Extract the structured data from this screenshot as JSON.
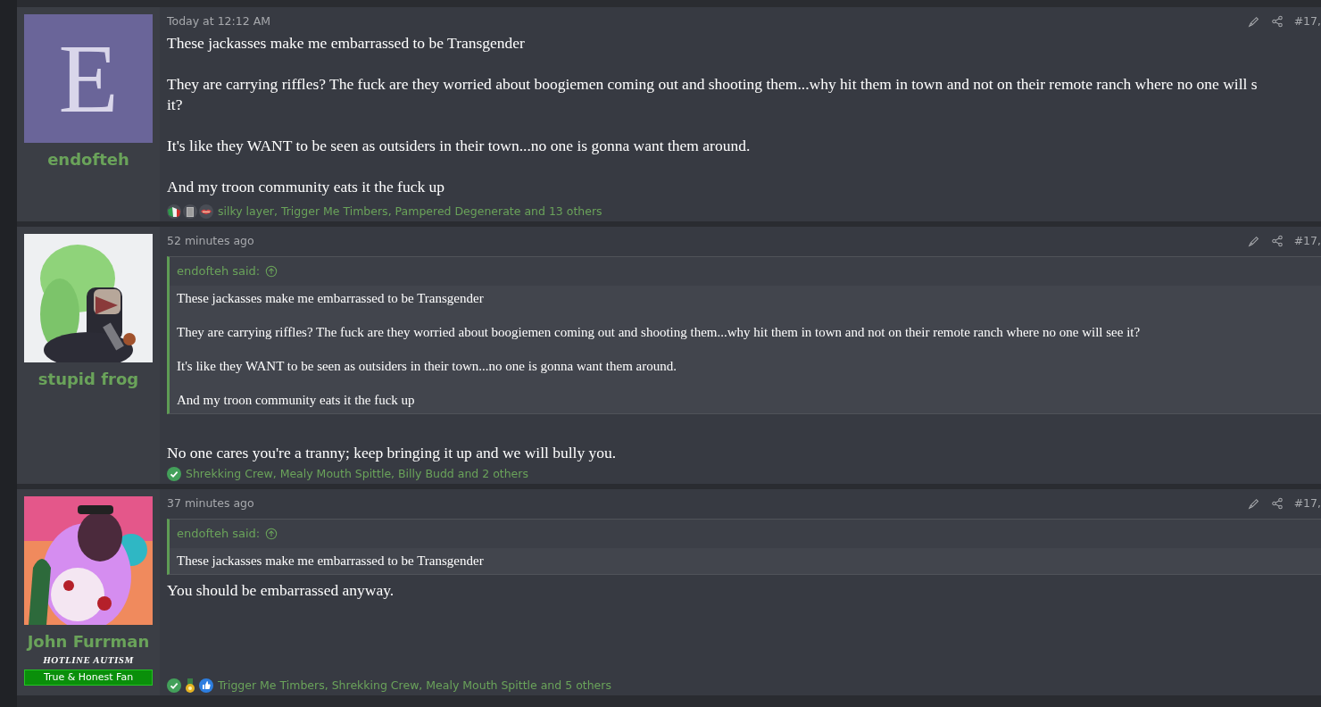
{
  "posts": [
    {
      "author": {
        "name": "endofteh",
        "avatar": {
          "kind": "letter",
          "letter": "E"
        }
      },
      "time": "Today at 12:12 AM",
      "post_number": "#17,",
      "paragraphs": [
        {
          "lines": [
            "These jackasses make me embarrassed to be Transgender"
          ]
        },
        {
          "lines": [
            "They are carrying riffles? The fuck are they worried about boogiemen coming out and shooting them...why hit them in town and not on their remote ranch where no one will s",
            "it?"
          ]
        },
        {
          "lines": [
            "It's like they WANT to be seen as outsiders in their town...no one is gonna want them around."
          ]
        },
        {
          "lines": [
            "And my troon community eats it the fuck up"
          ]
        }
      ],
      "reactions": {
        "icons": [
          {
            "kind": "flag"
          },
          {
            "kind": "can"
          },
          {
            "kind": "lips"
          }
        ],
        "text": "silky layer, Trigger Me Timbers, Pampered Degenerate and 13 others"
      }
    },
    {
      "author": {
        "name": "stupid frog"
      },
      "time": "52 minutes ago",
      "post_number": "#17,",
      "quote": {
        "author": "endofteh said:",
        "paragraphs": [
          "These jackasses make me embarrassed to be Transgender",
          "They are carrying riffles? The fuck are they worried about boogiemen coming out and shooting them...why hit them in town and not on their remote ranch where no one will see it?",
          "It's like they WANT to be seen as outsiders in their town...no one is gonna want them around.",
          "And my troon community eats it the fuck up"
        ]
      },
      "paragraphs": [
        {
          "lines": [
            "No one cares you're a tranny; keep bringing it up and we will bully you."
          ]
        }
      ],
      "reactions": {
        "icons": [
          {
            "kind": "check"
          }
        ],
        "text": "Shrekking Crew, Mealy Mouth Spittle, Billy Budd and 2 others"
      }
    },
    {
      "author": {
        "name": "John Furrman",
        "user_title": "HOTLINE AUTISM",
        "banner": "True & Honest Fan"
      },
      "time": "37 minutes ago",
      "post_number": "#17,",
      "quote": {
        "author": "endofteh said:",
        "paragraphs": [
          "These jackasses make me embarrassed to be Transgender"
        ]
      },
      "paragraphs": [
        {
          "lines": [
            "You should be embarrassed anyway."
          ]
        }
      ],
      "reactions": {
        "icons": [
          {
            "kind": "check"
          },
          {
            "kind": "medal"
          },
          {
            "kind": "like"
          }
        ],
        "text": "Trigger Me Timbers, Shrekking Crew, Mealy Mouth Spittle and 5 others"
      }
    }
  ]
}
